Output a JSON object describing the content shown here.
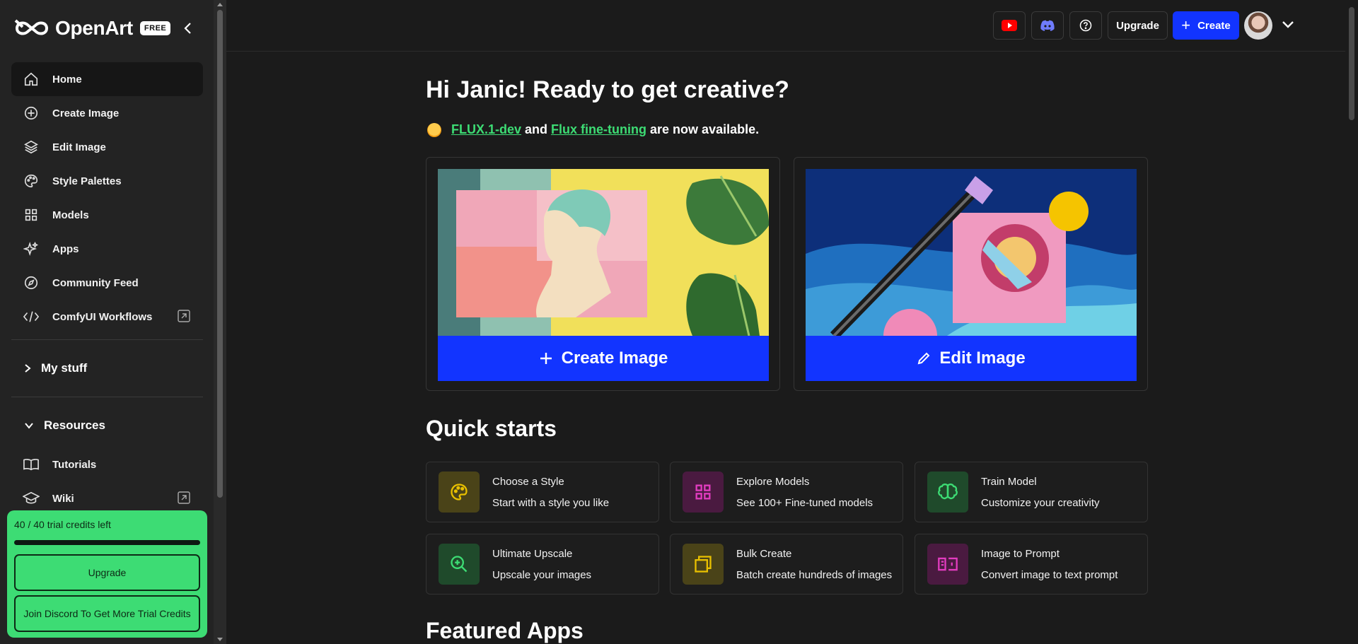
{
  "app": {
    "name": "OpenArt",
    "plan_badge": "FREE"
  },
  "sidebar": {
    "nav": [
      {
        "label": "Home",
        "icon": "home-icon",
        "active": true
      },
      {
        "label": "Create Image",
        "icon": "plus-circle-icon"
      },
      {
        "label": "Edit Image",
        "icon": "layers-icon"
      },
      {
        "label": "Style Palettes",
        "icon": "palette-icon"
      },
      {
        "label": "Models",
        "icon": "grid-icon"
      },
      {
        "label": "Apps",
        "icon": "sparkle-icon"
      },
      {
        "label": "Community Feed",
        "icon": "compass-icon"
      },
      {
        "label": "ComfyUI Workflows",
        "icon": "code-icon",
        "external": true
      }
    ],
    "my_stuff": "My stuff",
    "resources": "Resources",
    "resources_items": [
      {
        "label": "Tutorials",
        "icon": "book-icon"
      },
      {
        "label": "Wiki",
        "icon": "graduation-cap-icon",
        "external": true
      }
    ],
    "credits": {
      "text": "40 / 40 trial credits left",
      "fraction_remaining": 1.0,
      "upgrade_label": "Upgrade",
      "discord_label": "Join Discord To Get More Trial Credits"
    }
  },
  "topbar": {
    "youtube_icon": "youtube-icon",
    "discord_icon": "discord-icon",
    "help_icon": "help-icon",
    "upgrade_label": "Upgrade",
    "create_label": "Create"
  },
  "main": {
    "greeting": "Hi Janic!  Ready to get creative?",
    "announcement": {
      "link1": "FLUX.1-dev",
      "mid": " and ",
      "link2": "Flux fine-tuning",
      "tail": " are now available."
    },
    "hero_cards": [
      {
        "label": "Create Image",
        "icon": "plus-icon"
      },
      {
        "label": "Edit Image",
        "icon": "pencil-icon"
      }
    ],
    "quick_starts_title": "Quick starts",
    "quick_starts": [
      {
        "title": "Choose a Style",
        "subtitle": "Start with a style you like",
        "icon": "palette-icon",
        "color": "#e8c000",
        "bg": "#4a4318"
      },
      {
        "title": "Explore Models",
        "subtitle": "See 100+ Fine-tuned models",
        "icon": "grid-icon",
        "color": "#e23cbf",
        "bg": "#4a1a40"
      },
      {
        "title": "Train Model",
        "subtitle": "Customize your creativity",
        "icon": "brain-icon",
        "color": "#3ddc74",
        "bg": "#1f4a2b"
      },
      {
        "title": "Ultimate Upscale",
        "subtitle": "Upscale your images",
        "icon": "zoom-in-icon",
        "color": "#3ddc74",
        "bg": "#1f4a2b"
      },
      {
        "title": "Bulk Create",
        "subtitle": "Batch create hundreds of images",
        "icon": "copy-icon",
        "color": "#e8c000",
        "bg": "#4a4318"
      },
      {
        "title": "Image to Prompt",
        "subtitle": "Convert image to text prompt",
        "icon": "image-to-text-icon",
        "color": "#e23cbf",
        "bg": "#4a1a40"
      }
    ],
    "featured_apps_title": "Featured Apps"
  }
}
